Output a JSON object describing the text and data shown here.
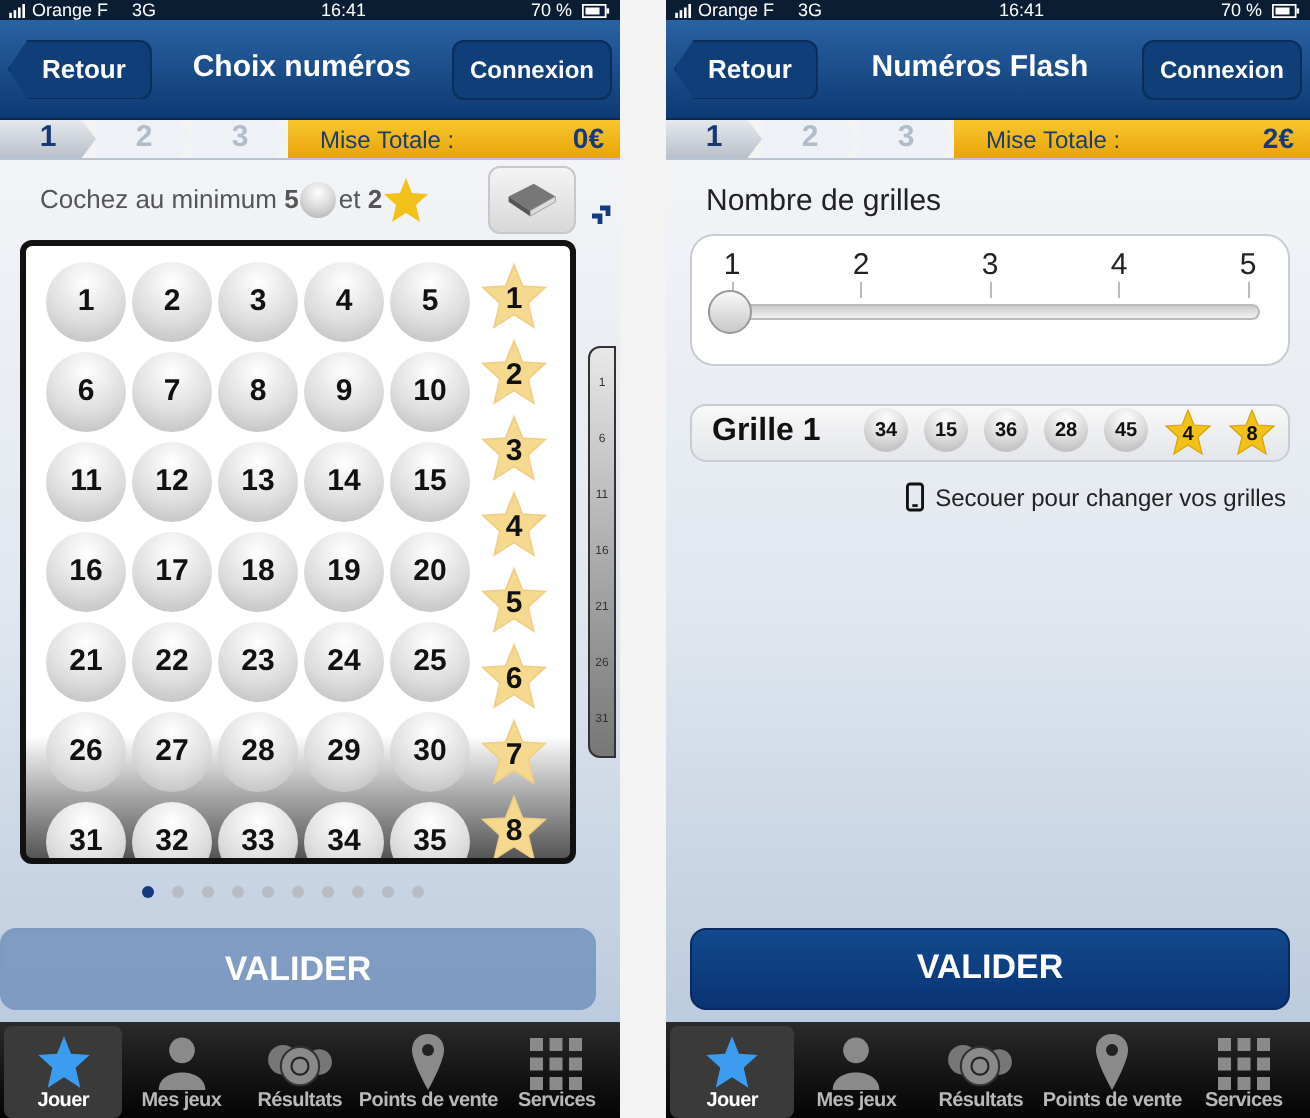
{
  "screens": [
    {
      "kind": "grid",
      "status_bar": {
        "carrier": "Orange F",
        "network": "3G",
        "time": "16:41",
        "battery": "70 %"
      },
      "nav": {
        "back": "Retour",
        "title": "Choix numéros",
        "action": "Connexion"
      },
      "steps": [
        {
          "label": "1",
          "selected": true
        },
        {
          "label": "2",
          "selected": false
        },
        {
          "label": "3",
          "selected": false
        }
      ],
      "total": {
        "label": "Mise Totale :",
        "value": "0€"
      },
      "instruction": {
        "numbers": "Cochez au minimum **5**",
        "stars": "et **2**"
      },
      "numbers": [
        {
          "label": "1",
          "selected": false
        },
        {
          "label": "2",
          "selected": false
        },
        {
          "label": "3",
          "selected": false
        },
        {
          "label": "4",
          "selected": false
        },
        {
          "label": "5",
          "selected": false
        },
        {
          "label": "6",
          "selected": false
        },
        {
          "label": "7",
          "selected": false
        },
        {
          "label": "8",
          "selected": false
        },
        {
          "label": "9",
          "selected": false
        },
        {
          "label": "10",
          "selected": false
        },
        {
          "label": "11",
          "selected": false
        },
        {
          "label": "12",
          "selected": false
        },
        {
          "label": "13",
          "selected": false
        },
        {
          "label": "14",
          "selected": false
        },
        {
          "label": "15",
          "selected": false
        },
        {
          "label": "16",
          "selected": false
        },
        {
          "label": "17",
          "selected": false
        },
        {
          "label": "18",
          "selected": false
        },
        {
          "label": "19",
          "selected": false
        },
        {
          "label": "20",
          "selected": false
        },
        {
          "label": "21",
          "selected": false
        },
        {
          "label": "22",
          "selected": false
        },
        {
          "label": "23",
          "selected": false
        },
        {
          "label": "24",
          "selected": false
        },
        {
          "label": "25",
          "selected": false
        },
        {
          "label": "26",
          "selected": false
        },
        {
          "label": "27",
          "selected": false
        },
        {
          "label": "28",
          "selected": false
        },
        {
          "label": "29",
          "selected": false
        },
        {
          "label": "30",
          "selected": false
        },
        {
          "label": "31",
          "selected": false
        },
        {
          "label": "32",
          "selected": false
        },
        {
          "label": "33",
          "selected": false
        },
        {
          "label": "34",
          "selected": false
        },
        {
          "label": "35",
          "selected": false
        }
      ],
      "stars": [
        {
          "label": "1",
          "selected": false
        },
        {
          "label": "2",
          "selected": false
        },
        {
          "label": "3",
          "selected": false
        },
        {
          "label": "4",
          "selected": false
        },
        {
          "label": "5",
          "selected": false
        },
        {
          "label": "6",
          "selected": false
        },
        {
          "label": "7",
          "selected": false
        },
        {
          "label": "8",
          "selected": false
        }
      ],
      "preview": [
        "1",
        "6",
        "11",
        "16",
        "21",
        "26",
        "31"
      ],
      "pager": [
        {
          "selected": true
        },
        {
          "selected": false
        },
        {
          "selected": false
        },
        {
          "selected": false
        },
        {
          "selected": false
        },
        {
          "selected": false
        },
        {
          "selected": false
        },
        {
          "selected": false
        },
        {
          "selected": false
        },
        {
          "selected": false
        }
      ],
      "submit": {
        "label": "VALIDER",
        "disabled": true
      },
      "tabs": [
        {
          "label": "Jouer",
          "selected": true
        },
        {
          "label": "Mes jeux",
          "selected": false
        },
        {
          "label": "Résultats",
          "selected": false
        },
        {
          "label": "Points de vente",
          "selected": false
        },
        {
          "label": "Services",
          "selected": false
        }
      ]
    },
    {
      "kind": "flash",
      "status_bar": {
        "carrier": "Orange F",
        "network": "3G",
        "time": "16:41",
        "battery": "70 %"
      },
      "nav": {
        "back": "Retour",
        "title": "Numéros Flash",
        "action": "Connexion"
      },
      "steps": [
        {
          "label": "1",
          "selected": true
        },
        {
          "label": "2",
          "selected": false
        },
        {
          "label": "3",
          "selected": false
        }
      ],
      "total": {
        "label": "Mise Totale :",
        "value": "2€"
      },
      "grid_count": {
        "label": "Nombre de grilles",
        "ticks": [
          "1",
          "2",
          "3",
          "4",
          "5"
        ],
        "level": 0
      },
      "grilles": [
        {
          "label": "Grille 1",
          "numbers": [
            "34",
            "15",
            "36",
            "28",
            "45"
          ],
          "stars": [
            "4",
            "8"
          ]
        }
      ],
      "hint": "Secouer pour changer vos grilles",
      "submit": {
        "label": "VALIDER",
        "disabled": false
      },
      "tabs": [
        {
          "label": "Jouer",
          "selected": true
        },
        {
          "label": "Mes jeux",
          "selected": false
        },
        {
          "label": "Résultats",
          "selected": false
        },
        {
          "label": "Points de vente",
          "selected": false
        },
        {
          "label": "Services",
          "selected": false
        }
      ]
    }
  ]
}
